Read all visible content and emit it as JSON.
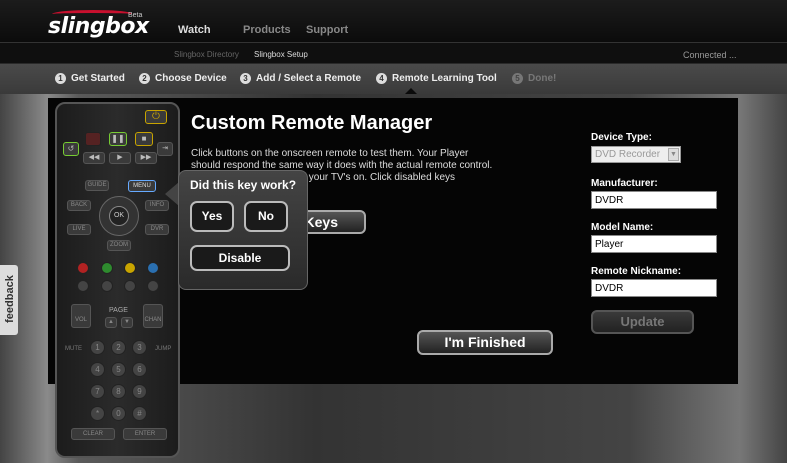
{
  "header": {
    "logo": "slingbox",
    "beta": "Beta",
    "nav": [
      "Watch",
      "Products",
      "Support"
    ]
  },
  "subnav": {
    "items": [
      "Slingbox Directory",
      "Slingbox Setup"
    ],
    "status": "Connected ..."
  },
  "steps": [
    {
      "num": "1",
      "label": "Get Started",
      "active": true
    },
    {
      "num": "2",
      "label": "Choose Device",
      "active": true
    },
    {
      "num": "3",
      "label": "Add / Select a Remote",
      "active": true
    },
    {
      "num": "4",
      "label": "Remote Learning Tool",
      "active": true
    },
    {
      "num": "5",
      "label": "Done!",
      "active": false
    }
  ],
  "main": {
    "title": "Custom Remote Manager",
    "instructions_l1": "Click buttons on the onscreen remote to test them. Your Player",
    "instructions_l2": "should respond the same way it does with the actual remote control.",
    "instructions_l3": "if your TV's on. Click disabled keys",
    "keys_button": "Keys",
    "finished_button": "I'm Finished"
  },
  "popup": {
    "title": "Did this key work?",
    "yes": "Yes",
    "no": "No",
    "disable": "Disable"
  },
  "device": {
    "type_label": "Device Type:",
    "type_value": "DVD Recorder",
    "manufacturer_label": "Manufacturer:",
    "manufacturer_value": "DVDR",
    "model_label": "Model Name:",
    "model_value": "Player",
    "nickname_label": "Remote Nickname:",
    "nickname_value": "DVDR",
    "update_button": "Update"
  },
  "remote": {
    "guide": "GUIDE",
    "menu": "MENU",
    "back": "BACK",
    "info": "INFO",
    "ok": "OK",
    "live": "LIVE",
    "dvr": "DVR",
    "zoom": "ZOOM",
    "page": "PAGE",
    "vol": "VOL",
    "chan": "CHAN",
    "mute": "MUTE",
    "jump": "JUMP",
    "digits": [
      "1",
      "2",
      "3",
      "4",
      "5",
      "6",
      "7",
      "8",
      "9",
      "*",
      "0",
      "#"
    ],
    "clear": "CLEAR",
    "enter": "ENTER",
    "colors": [
      "#b22222",
      "#2e8b2e",
      "#c8a400",
      "#2a6fb0"
    ]
  },
  "feedback": "feedback"
}
